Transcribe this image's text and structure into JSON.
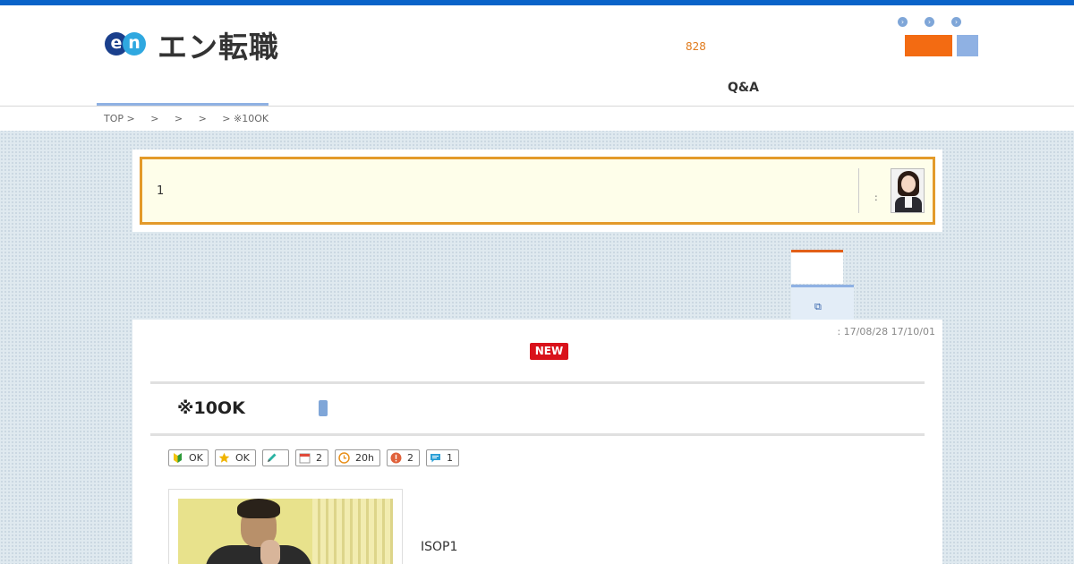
{
  "header": {
    "logo_e": "e",
    "logo_n": "n",
    "logo_text": "エン転職",
    "count": "828",
    "dots": [
      "›",
      "›",
      "›"
    ],
    "qa_label": "Q&A",
    "colors": {
      "topbar": "#0a63c9",
      "accent_orange": "#f36b12",
      "accent_blue": "#8fb1e3"
    }
  },
  "breadcrumb": "TOP >     >     >     >     > ※10OK",
  "alert": {
    "text": "1",
    "colon": ":",
    "avatar_icon": "consultant-avatar"
  },
  "tabs": {
    "link_icon": "⧉"
  },
  "post": {
    "dates": ": 17/08/28 17/10/01",
    "new_badge": "NEW",
    "title": "※10OK",
    "tags": [
      {
        "icon": "beginner-mark-icon",
        "text": "OK"
      },
      {
        "icon": "star-icon",
        "text": "OK"
      },
      {
        "icon": "pencil-icon",
        "text": ""
      },
      {
        "icon": "calendar-icon",
        "text": "2"
      },
      {
        "icon": "clock-icon",
        "text": "20h"
      },
      {
        "icon": "alert-icon",
        "text": "2"
      },
      {
        "icon": "comment-icon",
        "text": "1"
      }
    ],
    "body_text": "ISOP1"
  }
}
